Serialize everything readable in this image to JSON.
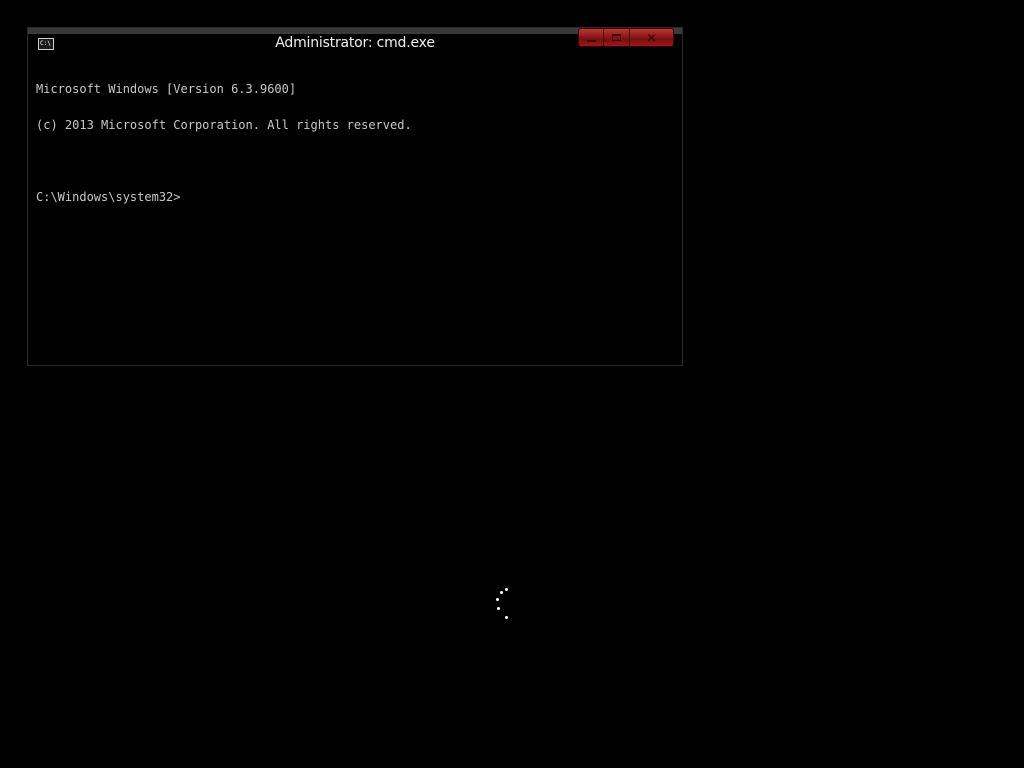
{
  "window": {
    "title": "Administrator: cmd.exe",
    "icon": "cmd-app-icon",
    "icon_text": "C:\\",
    "controls": {
      "minimize_icon": "minimize-icon",
      "maximize_icon": "maximize-icon",
      "close_glyph": "✕",
      "accent_color": "#b01e1e"
    }
  },
  "console": {
    "lines": [
      "Microsoft Windows [Version 6.3.9600]",
      "(c) 2013 Microsoft Corporation. All rights reserved.",
      "",
      "C:\\Windows\\system32>"
    ]
  },
  "desktop": {
    "background_color": "#000000",
    "loading_indicator": "spinner-dots"
  }
}
